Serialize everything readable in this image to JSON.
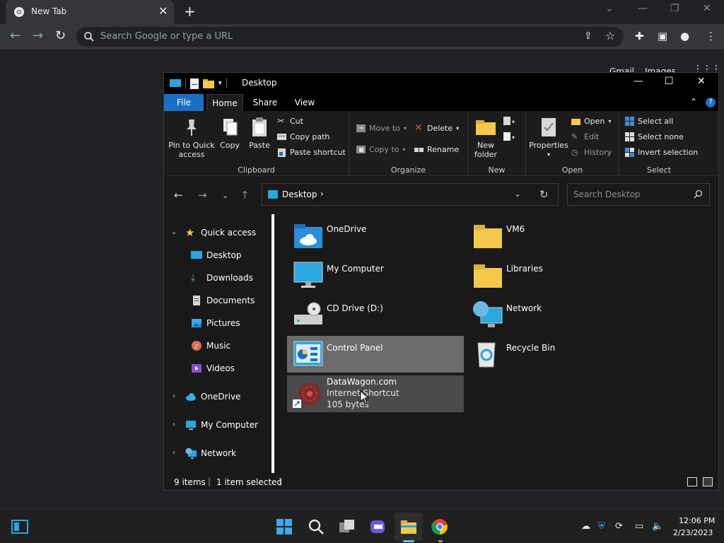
{
  "browser": {
    "tab_title": "New Tab",
    "tab_close": "✕",
    "new_tab": "+",
    "omnibox_placeholder": "Search Google or type a URL",
    "peek_gmail": "Gmail",
    "peek_images": "Images"
  },
  "explorer": {
    "title": "Desktop",
    "ribbon_tabs": [
      "File",
      "Home",
      "Share",
      "View"
    ],
    "clipboard": {
      "pin_label": "Pin to Quick access",
      "copy_label": "Copy",
      "paste_label": "Paste",
      "cut_label": "Cut",
      "copy_path_label": "Copy path",
      "paste_shortcut_label": "Paste shortcut",
      "group_label": "Clipboard"
    },
    "organize": {
      "move_to_label": "Move to",
      "copy_to_label": "Copy to",
      "delete_label": "Delete",
      "rename_label": "Rename",
      "group_label": "Organize"
    },
    "new": {
      "new_folder_label": "New folder",
      "group_label": "New"
    },
    "open": {
      "properties_label": "Properties",
      "open_label": "Open",
      "edit_label": "Edit",
      "history_label": "History",
      "group_label": "Open"
    },
    "select": {
      "select_all_label": "Select all",
      "select_none_label": "Select none",
      "invert_label": "Invert selection",
      "group_label": "Select"
    },
    "address": {
      "location": "Desktop",
      "separator": "›",
      "search_placeholder": "Search Desktop"
    },
    "nav": {
      "quick_access": "Quick access",
      "desktop": "Desktop",
      "downloads": "Downloads",
      "documents": "Documents",
      "pictures": "Pictures",
      "music": "Music",
      "videos": "Videos",
      "onedrive": "OneDrive",
      "my_computer": "My Computer",
      "network": "Network"
    },
    "items": {
      "onedrive": "OneDrive",
      "vm6": "VM6",
      "my_computer": "My Computer",
      "libraries": "Libraries",
      "cd_drive": "CD Drive (D:)",
      "network": "Network",
      "control_panel": "Control Panel",
      "recycle_bin": "Recycle Bin",
      "datawagon_name": "DataWagon.com",
      "datawagon_type": "Internet Shortcut",
      "datawagon_size": "105 bytes"
    },
    "status": {
      "item_count": "9 items",
      "selected": "1 item selected"
    }
  },
  "taskbar": {
    "time": "12:06 PM",
    "date": "2/23/2023"
  },
  "colors": {
    "accent": "#1a6fc4",
    "folder": "#f3c84c",
    "chrome_bg": "#202124"
  }
}
